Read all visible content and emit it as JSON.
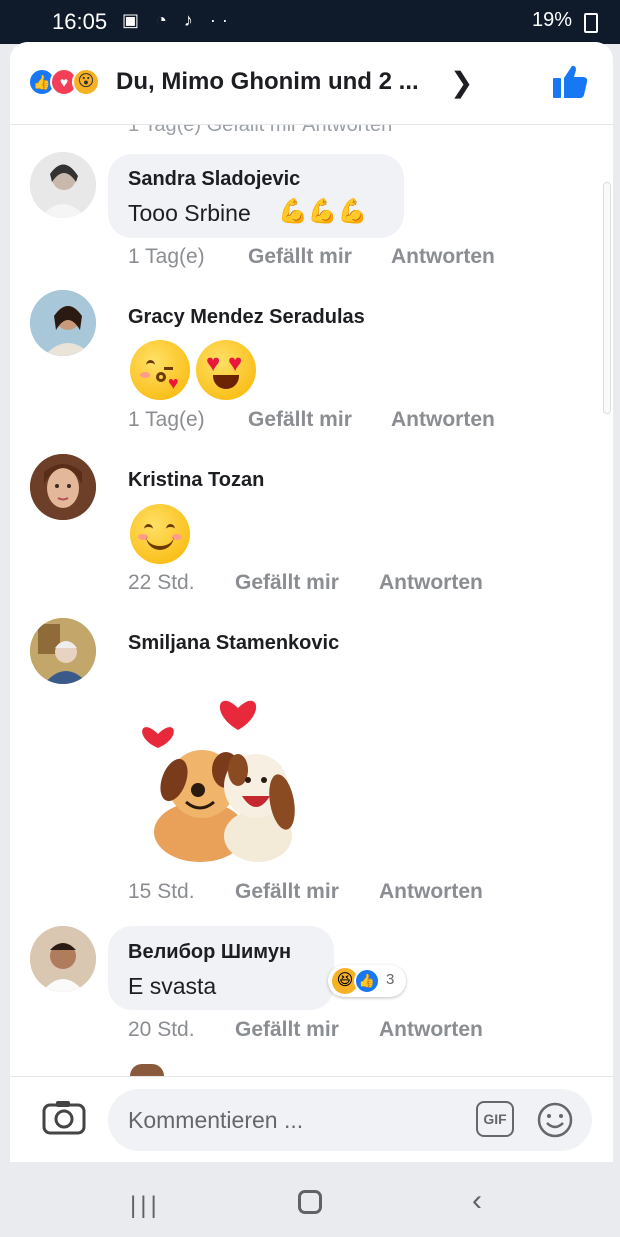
{
  "status_bar": {
    "time": "16:05",
    "battery": "19%",
    "left_icons": "▣ ◔ ♪ ··",
    "right_icons": "✕ H ▮"
  },
  "header": {
    "title": "Du, Mimo Ghonim und 2 ...",
    "reactions": [
      "like",
      "love",
      "wow"
    ]
  },
  "partial_meta_top": "1 Tag(e)    Gefällt mir    Antworten",
  "comments": [
    {
      "name": "Sandra Sladojevic",
      "text": "Tooo Srbine",
      "emoji": "💪💪💪",
      "time": "1 Tag(e)",
      "like_label": "Gefällt mir",
      "reply_label": "Antworten"
    },
    {
      "name": "Gracy Mendez Seradulas",
      "emoji": [
        "kissing-face",
        "heart-eyes-face"
      ],
      "time": "1 Tag(e)",
      "like_label": "Gefällt mir",
      "reply_label": "Antworten"
    },
    {
      "name": "Kristina Tozan",
      "emoji": [
        "smiling-face"
      ],
      "time": "22 Std.",
      "like_label": "Gefällt mir",
      "reply_label": "Antworten"
    },
    {
      "name": "Smiljana Stamenkovic",
      "sticker": "two-puppies-hugging-with-hearts",
      "time": "15 Std.",
      "like_label": "Gefällt mir",
      "reply_label": "Antworten"
    },
    {
      "name": "Велибор Шимун",
      "text": "E svasta",
      "reaction_count": "3",
      "time": "20 Std.",
      "like_label": "Gefällt mir",
      "reply_label": "Antworten"
    }
  ],
  "composer": {
    "placeholder": "Kommentieren ...",
    "gif_label": "GIF"
  },
  "colors": {
    "facebook_blue": "#1877f2",
    "meta_gray": "#8a8d91",
    "bubble_bg": "#f0f2f5"
  }
}
